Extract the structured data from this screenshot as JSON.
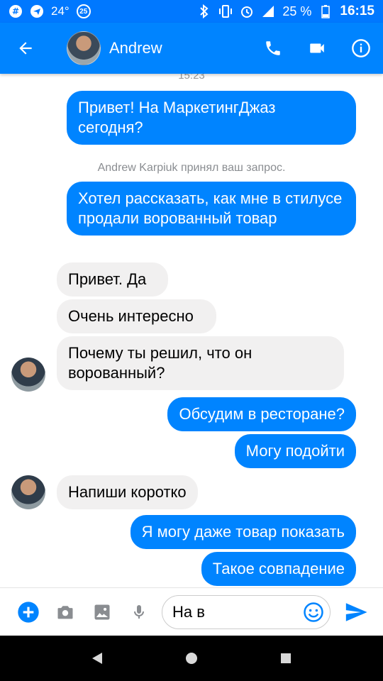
{
  "status_bar": {
    "temperature": "24°",
    "badge_number": "25",
    "battery_text": "25 %",
    "time": "16:15"
  },
  "header": {
    "contact_name": "Andrew"
  },
  "conversation": {
    "timestamp": "15:23",
    "system_note": "Andrew Karpiuk принял ваш запрос.",
    "messages": [
      {
        "from": "me",
        "text": "Привет! На МаркетингДжаз сегодня?"
      },
      {
        "from": "me",
        "text": "Хотел рассказать, как мне в стилусе продали ворованный товар"
      },
      {
        "from": "them",
        "text": "Привет. Да"
      },
      {
        "from": "them",
        "text": "Очень интересно"
      },
      {
        "from": "them",
        "text": "Почему ты решил, что он ворованный?"
      },
      {
        "from": "me",
        "text": "Обсудим в ресторане?"
      },
      {
        "from": "me",
        "text": "Могу подойти"
      },
      {
        "from": "them",
        "text": "Напиши коротко"
      },
      {
        "from": "me",
        "text": "Я могу даже товар показать"
      },
      {
        "from": "me",
        "text": "Такое совпадение"
      }
    ]
  },
  "composer": {
    "input_value": "На в"
  },
  "colors": {
    "accent": "#0084ff",
    "status_bar": "#0078ff",
    "incoming_bubble": "#f1f0f0"
  },
  "icons": {
    "header": [
      "back-arrow-icon",
      "phone-icon",
      "video-camera-icon",
      "info-icon"
    ],
    "composer": [
      "plus-icon",
      "camera-icon",
      "image-icon",
      "microphone-icon",
      "emoji-icon",
      "send-icon"
    ],
    "nav": [
      "back-triangle-icon",
      "home-circle-icon",
      "recents-square-icon"
    ]
  }
}
